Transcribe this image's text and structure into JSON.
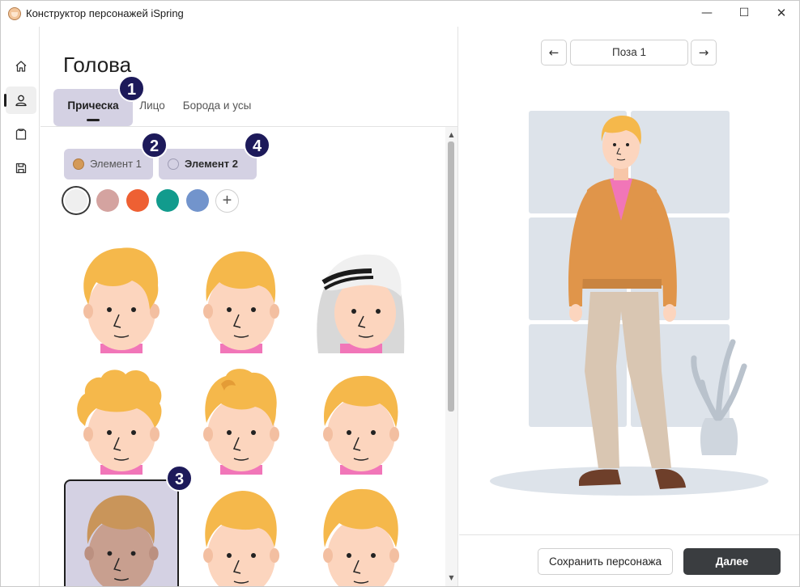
{
  "window": {
    "title": "Конструктор персонажей iSpring",
    "minimize_glyph": "—",
    "maximize_glyph": "☐",
    "close_glyph": "✕"
  },
  "rail": {
    "items": [
      {
        "name": "home-icon",
        "active": false
      },
      {
        "name": "user-icon",
        "active": true
      },
      {
        "name": "shirt-icon",
        "active": false
      },
      {
        "name": "save-icon",
        "active": false
      }
    ]
  },
  "panel": {
    "title": "Голова",
    "tabs": [
      {
        "label": "Прическа",
        "active": true
      },
      {
        "label": "Лицо",
        "active": false
      },
      {
        "label": "Борода и усы",
        "active": false
      }
    ],
    "elements": [
      {
        "label": "Элемент 1",
        "color": "#d49a58"
      },
      {
        "label": "Элемент 2",
        "color": ""
      }
    ],
    "swatches": [
      {
        "color": "#efefef",
        "selected": true
      },
      {
        "color": "#d4a3a0",
        "selected": false
      },
      {
        "color": "#ee6033",
        "selected": false
      },
      {
        "color": "#129b8d",
        "selected": false
      },
      {
        "color": "#7294cc",
        "selected": false
      }
    ],
    "add_swatch_label": "+",
    "badges": [
      "1",
      "2",
      "3",
      "4"
    ]
  },
  "preview": {
    "pose_label": "Поза 1",
    "prev_glyph": "←",
    "next_glyph": "→"
  },
  "footer": {
    "save_label": "Сохранить персонажа",
    "next_label": "Далее"
  },
  "colors": {
    "accent": "#d4d1e3",
    "badge": "#1d1a5a",
    "hair": "#f5b84b",
    "skin": "#fcd5be",
    "cardigan": "#e0954a",
    "shirt": "#f176b8",
    "trousers": "#d9c6b2",
    "shoes": "#6e3f2a",
    "backdrop": "#dde3ea"
  }
}
